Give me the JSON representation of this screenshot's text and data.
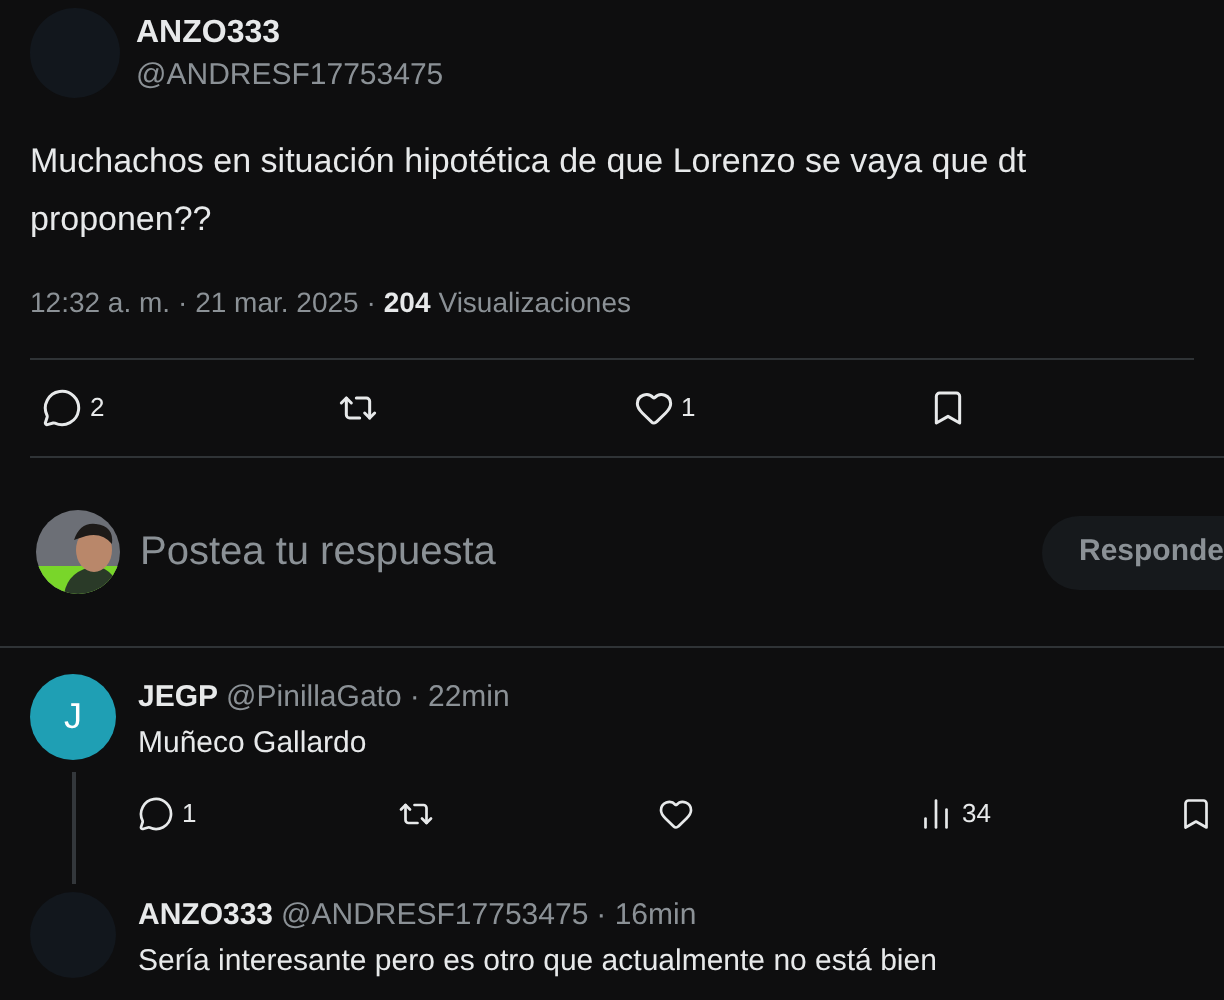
{
  "tweet": {
    "author": {
      "name": "ANZO333",
      "handle": "@ANDRESF17753475"
    },
    "text": "Muchachos en situación hipotética de que Lorenzo se vaya que dt proponen??",
    "time": "12:32 a. m.",
    "date": "· 21 mar. 2025 ·",
    "views_count": "204",
    "views_label": "Visualizaciones",
    "actions": [
      {
        "kind": "reply",
        "count": "2"
      },
      {
        "kind": "repost"
      },
      {
        "kind": "like",
        "count": "1"
      },
      {
        "kind": "bookmark"
      }
    ]
  },
  "composer": {
    "placeholder": "Postea tu respuesta",
    "button": "Responde"
  },
  "replies": [
    {
      "name": "JEGP",
      "handle": "@PinillaGato",
      "time": "· 22min",
      "text": "Muñeco Gallardo",
      "avatar": {
        "kind": "letter",
        "letter": "J",
        "color": "#1f9fb4"
      },
      "thread": true,
      "actions": [
        {
          "kind": "reply",
          "count": "1"
        },
        {
          "kind": "repost"
        },
        {
          "kind": "like"
        },
        {
          "kind": "views",
          "count": "34"
        },
        {
          "kind": "bookmark"
        }
      ]
    },
    {
      "name": "ANZO333",
      "handle": "@ANDRESF17753475",
      "time": "· 16min",
      "text": "Sería interesante pero es otro que actualmente no está bien",
      "avatar": {
        "kind": "blank"
      },
      "thread": false
    }
  ]
}
